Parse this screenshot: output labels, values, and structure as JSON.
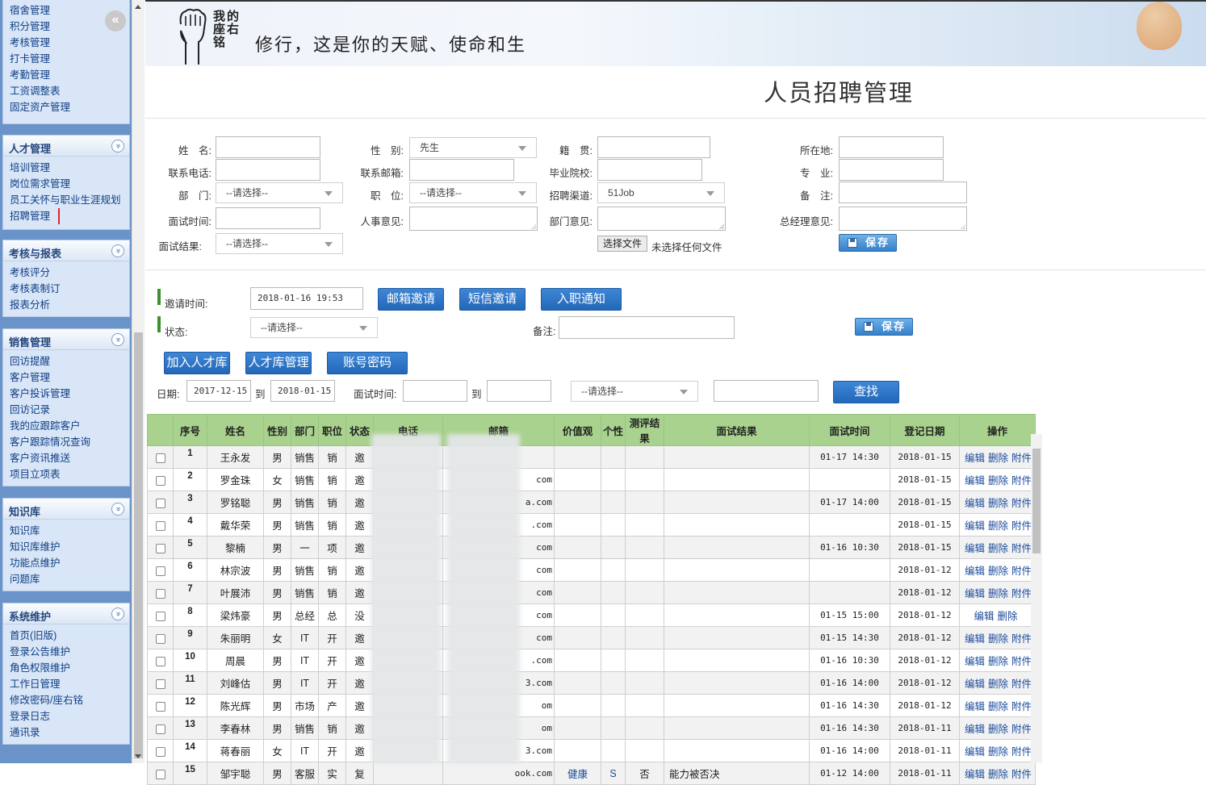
{
  "sidebar": {
    "top_items": [
      "宿舍管理",
      "积分管理",
      "考核管理",
      "打卡管理",
      "考勤管理",
      "工资调整表",
      "固定资产管理"
    ],
    "sections": [
      {
        "title": "人才管理",
        "items": [
          "培训管理",
          "岗位需求管理",
          "员工关怀与职业生涯规划",
          "招聘管理"
        ]
      },
      {
        "title": "考核与报表",
        "items": [
          "考核评分",
          "考核表制订",
          "报表分析"
        ]
      },
      {
        "title": "销售管理",
        "items": [
          "回访提醒",
          "客户管理",
          "客户投诉管理",
          "回访记录",
          "我的应跟踪客户",
          "客户跟踪情况查询",
          "客户资讯推送",
          "项目立项表"
        ]
      },
      {
        "title": "知识库",
        "items": [
          "知识库",
          "知识库维护",
          "功能点维护",
          "问题库"
        ]
      },
      {
        "title": "系统维护",
        "items": [
          "首页(旧版)",
          "登录公告维护",
          "角色权限维护",
          "工作日管理",
          "修改密码/座右铭",
          "登录日志",
          "通讯录"
        ]
      }
    ],
    "active_item": "招聘管理",
    "collapse_glyph": "«",
    "section_glyph": "»"
  },
  "banner": {
    "motto_label": "我的座右铭",
    "motto": "修行，这是你的天赋、使命和生"
  },
  "page_title": "人员招聘管理",
  "form": {
    "name_label": "姓　名:",
    "name_value": "",
    "gender_label": "性　别:",
    "gender_value": "先生",
    "native_label": "籍　贯:",
    "native_value": "",
    "location_label": "所在地:",
    "location_value": "",
    "phone_label": "联系电话:",
    "phone_value": "",
    "email_label": "联系邮箱:",
    "email_value": "",
    "school_label": "毕业院校:",
    "school_value": "",
    "major_label": "专　业:",
    "major_value": "",
    "dept_label": "部　门:",
    "dept_value": "--请选择--",
    "position_label": "职　位:",
    "position_value": "--请选择--",
    "channel_label": "招聘渠道:",
    "channel_value": "51Job",
    "remark_label": "备　注:",
    "remark_value": "",
    "interview_time_label": "面试时间:",
    "interview_time_value": "",
    "hr_opinion_label": "人事意见:",
    "dept_opinion_label": "部门意见:",
    "gm_opinion_label": "总经理意见:",
    "interview_result_label": "面试结果:",
    "interview_result_value": "--请选择--",
    "choose_file_label": "选择文件",
    "no_file_text": "未选择任何文件",
    "save_label": "保存"
  },
  "invite": {
    "time_label": "邀请时间:",
    "time_value": "2018-01-16 19:53",
    "email_invite": "邮箱邀请",
    "sms_invite": "短信邀请",
    "onboard_notice": "入职通知",
    "status_label": "状态:",
    "status_value": "--请选择--",
    "remark_label": "备注:",
    "remark_value": "",
    "save_label": "保存"
  },
  "actions": {
    "add_talent": "加入人才库",
    "talent_manage": "人才库管理",
    "account_pwd": "账号密码"
  },
  "filter": {
    "date_label": "日期:",
    "date_from": "2017-12-15",
    "to_label": "到",
    "date_to": "2018-01-15",
    "interview_label": "面试时间:",
    "interview_from": "",
    "interview_to": "",
    "select_value": "--请选择--",
    "keyword": "",
    "search": "查找"
  },
  "table": {
    "headers": [
      "序号",
      "姓名",
      "性别",
      "部门",
      "职位",
      "状态",
      "电话",
      "邮箱",
      "价值观",
      "个性",
      "测评结果",
      "面试结果",
      "面试时间",
      "登记日期",
      "操作"
    ],
    "op_labels": [
      "编辑",
      "删除",
      "附件"
    ],
    "rows": [
      {
        "seq": "1",
        "name": "王永发",
        "gender": "男",
        "dept": "销售",
        "pos": "销",
        "status": "邀",
        "email": "",
        "values": "",
        "person": "",
        "eval": "",
        "result": "",
        "itime": "01-17 14:30",
        "rdate": "2018-01-15",
        "ops": [
          "编辑",
          "删除",
          "附件"
        ]
      },
      {
        "seq": "2",
        "name": "罗金珠",
        "gender": "女",
        "dept": "销售",
        "pos": "销",
        "status": "邀",
        "email": "com",
        "values": "",
        "person": "",
        "eval": "",
        "result": "",
        "itime": "",
        "rdate": "2018-01-15",
        "ops": [
          "编辑",
          "删除",
          "附件"
        ]
      },
      {
        "seq": "3",
        "name": "罗铭聪",
        "gender": "男",
        "dept": "销售",
        "pos": "销",
        "status": "邀",
        "email": "a.com",
        "values": "",
        "person": "",
        "eval": "",
        "result": "",
        "itime": "01-17 14:00",
        "rdate": "2018-01-15",
        "ops": [
          "编辑",
          "删除",
          "附件"
        ]
      },
      {
        "seq": "4",
        "name": "戴华荣",
        "gender": "男",
        "dept": "销售",
        "pos": "销",
        "status": "邀",
        "email": ".com",
        "values": "",
        "person": "",
        "eval": "",
        "result": "",
        "itime": "",
        "rdate": "2018-01-15",
        "ops": [
          "编辑",
          "删除",
          "附件"
        ]
      },
      {
        "seq": "5",
        "name": "黎楠",
        "gender": "男",
        "dept": "一",
        "pos": "项",
        "status": "邀",
        "email": "com",
        "values": "",
        "person": "",
        "eval": "",
        "result": "",
        "itime": "01-16 10:30",
        "rdate": "2018-01-15",
        "ops": [
          "编辑",
          "删除",
          "附件"
        ]
      },
      {
        "seq": "6",
        "name": "林宗波",
        "gender": "男",
        "dept": "销售",
        "pos": "销",
        "status": "邀",
        "email": "com",
        "values": "",
        "person": "",
        "eval": "",
        "result": "",
        "itime": "",
        "rdate": "2018-01-12",
        "ops": [
          "编辑",
          "删除",
          "附件"
        ]
      },
      {
        "seq": "7",
        "name": "叶展沛",
        "gender": "男",
        "dept": "销售",
        "pos": "销",
        "status": "邀",
        "email": "com",
        "values": "",
        "person": "",
        "eval": "",
        "result": "",
        "itime": "",
        "rdate": "2018-01-12",
        "ops": [
          "编辑",
          "删除",
          "附件"
        ]
      },
      {
        "seq": "8",
        "name": "梁炜豪",
        "gender": "男",
        "dept": "总经",
        "pos": "总",
        "status": "没",
        "email": "com",
        "values": "",
        "person": "",
        "eval": "",
        "result": "",
        "itime": "01-15 15:00",
        "rdate": "2018-01-12",
        "ops": [
          "编辑",
          "删除"
        ]
      },
      {
        "seq": "9",
        "name": "朱丽明",
        "gender": "女",
        "dept": "IT",
        "pos": "开",
        "status": "邀",
        "email": "com",
        "values": "",
        "person": "",
        "eval": "",
        "result": "",
        "itime": "01-15 14:30",
        "rdate": "2018-01-12",
        "ops": [
          "编辑",
          "删除",
          "附件"
        ]
      },
      {
        "seq": "10",
        "name": "周晨",
        "gender": "男",
        "dept": "IT",
        "pos": "开",
        "status": "邀",
        "email": ".com",
        "values": "",
        "person": "",
        "eval": "",
        "result": "",
        "itime": "01-16 10:30",
        "rdate": "2018-01-12",
        "ops": [
          "编辑",
          "删除",
          "附件"
        ]
      },
      {
        "seq": "11",
        "name": "刘峰估",
        "gender": "男",
        "dept": "IT",
        "pos": "开",
        "status": "邀",
        "email": "3.com",
        "values": "",
        "person": "",
        "eval": "",
        "result": "",
        "itime": "01-16 14:00",
        "rdate": "2018-01-12",
        "ops": [
          "编辑",
          "删除",
          "附件"
        ]
      },
      {
        "seq": "12",
        "name": "陈光辉",
        "gender": "男",
        "dept": "市场",
        "pos": "产",
        "status": "邀",
        "email": "om",
        "values": "",
        "person": "",
        "eval": "",
        "result": "",
        "itime": "01-16 14:30",
        "rdate": "2018-01-12",
        "ops": [
          "编辑",
          "删除",
          "附件"
        ]
      },
      {
        "seq": "13",
        "name": "李春林",
        "gender": "男",
        "dept": "销售",
        "pos": "销",
        "status": "邀",
        "email": "om",
        "values": "",
        "person": "",
        "eval": "",
        "result": "",
        "itime": "01-16 14:30",
        "rdate": "2018-01-11",
        "ops": [
          "编辑",
          "删除",
          "附件"
        ]
      },
      {
        "seq": "14",
        "name": "蒋春丽",
        "gender": "女",
        "dept": "IT",
        "pos": "开",
        "status": "邀",
        "email": "3.com",
        "values": "",
        "person": "",
        "eval": "",
        "result": "",
        "itime": "01-16 14:00",
        "rdate": "2018-01-11",
        "ops": [
          "编辑",
          "删除",
          "附件"
        ]
      },
      {
        "seq": "15",
        "name": "邹宇聪",
        "gender": "男",
        "dept": "客服",
        "pos": "实",
        "status": "复",
        "email": "ook.com",
        "values": "健康",
        "person": "S",
        "eval": "否",
        "result": "能力被否决",
        "itime": "01-12 14:00",
        "rdate": "2018-01-11",
        "ops": [
          "编辑",
          "删除",
          "附件"
        ]
      }
    ]
  }
}
